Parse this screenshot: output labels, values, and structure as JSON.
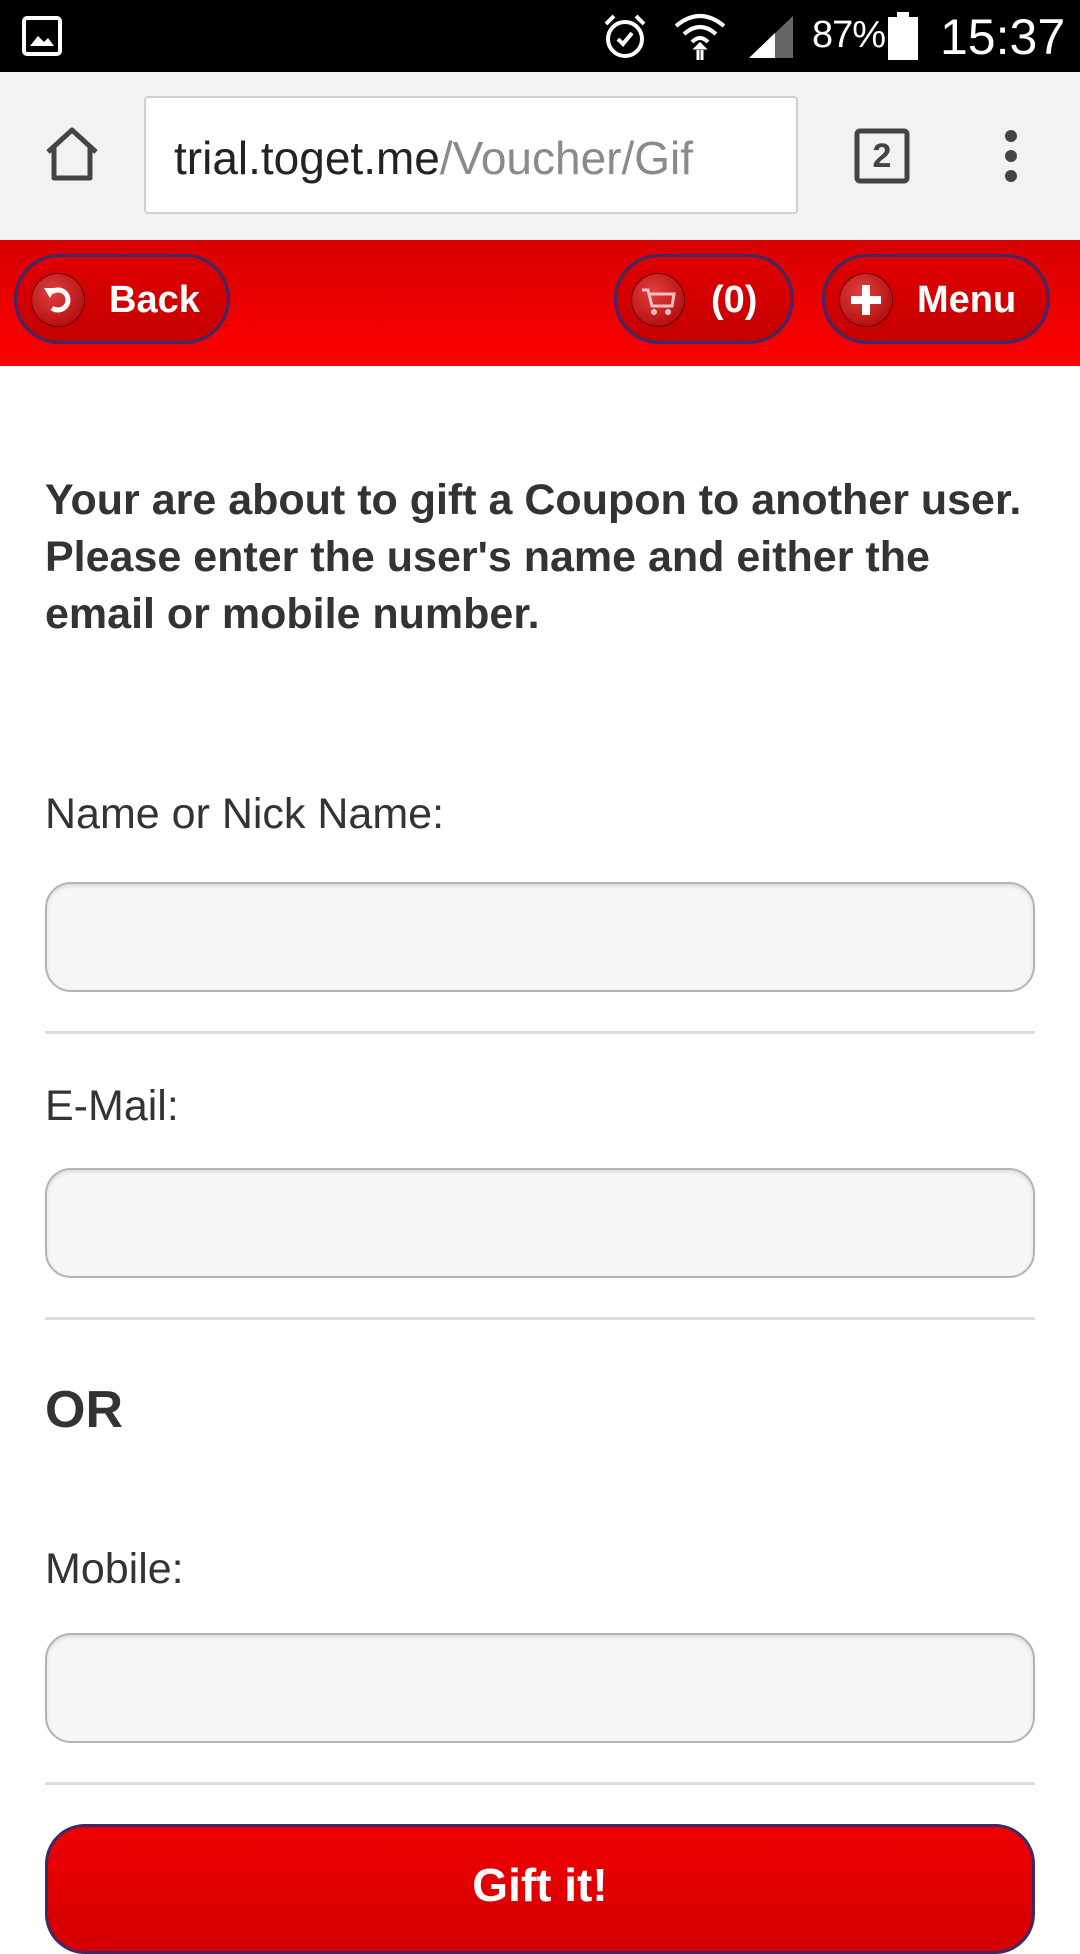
{
  "status_bar": {
    "battery_percent": "87%",
    "time": "15:37",
    "icons": [
      "gallery-icon",
      "alarm-icon",
      "wifi-icon",
      "signal-icon",
      "battery-icon"
    ]
  },
  "browser": {
    "url_domain": "trial.toget.me",
    "url_path": "/Voucher/Gif",
    "tab_count": "2"
  },
  "nav": {
    "back_label": "Back",
    "cart_label": "(0)",
    "menu_label": "Menu"
  },
  "form": {
    "intro": "Your are about to gift a Coupon to another user. Please enter the user's name and either the email or mobile number.",
    "name_label": "Name or Nick Name:",
    "name_value": "",
    "email_label": "E-Mail:",
    "email_value": "",
    "or_text": "OR",
    "mobile_label": "Mobile:",
    "mobile_value": "",
    "submit_label": "Gift it!"
  },
  "colors": {
    "nav_red": "#ff0000",
    "button_red": "#e00000",
    "pill_border": "#3a2a6a"
  }
}
